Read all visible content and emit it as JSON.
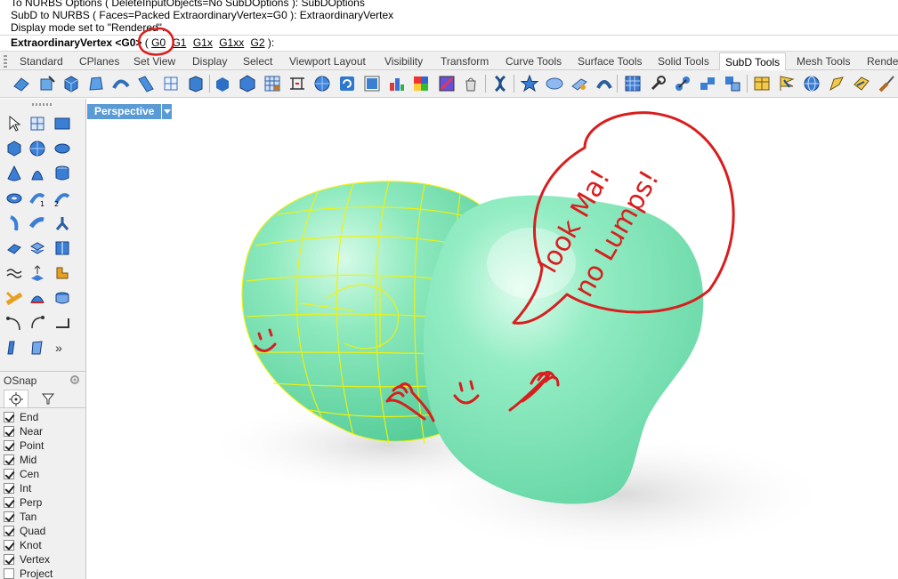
{
  "command_history": {
    "lines": [
      "To NURBS Options ( DeleteInputObjects=No  SubDOptions ): SubDOptions",
      "SubD to NURBS ( Faces=Packed  ExtraordinaryVertex=G0 ): ExtraordinaryVertex",
      "Display mode set to \"Rendered\"."
    ]
  },
  "command_prompt": {
    "prompt": "ExtraordinaryVertex <G0>",
    "open_paren": "( ",
    "options": [
      "G0",
      "G1",
      "G1x",
      "G1xx",
      "G2"
    ],
    "close": " ):"
  },
  "tabs": [
    "Standard",
    "CPlanes",
    "Set View",
    "Display",
    "Select",
    "Viewport Layout",
    "Visibility",
    "Transform",
    "Curve Tools",
    "Surface Tools",
    "Solid Tools",
    "SubD Tools",
    "Mesh Tools",
    "Rende"
  ],
  "active_tab": "SubD Tools",
  "viewport": {
    "title": "Perspective",
    "display_mode": "Rendered"
  },
  "osnap": {
    "title": "OSnap",
    "items": [
      {
        "label": "End",
        "checked": true
      },
      {
        "label": "Near",
        "checked": true
      },
      {
        "label": "Point",
        "checked": true
      },
      {
        "label": "Mid",
        "checked": true
      },
      {
        "label": "Cen",
        "checked": true
      },
      {
        "label": "Int",
        "checked": true
      },
      {
        "label": "Perp",
        "checked": true
      },
      {
        "label": "Tan",
        "checked": true
      },
      {
        "label": "Quad",
        "checked": true
      },
      {
        "label": "Knot",
        "checked": true
      },
      {
        "label": "Vertex",
        "checked": true
      },
      {
        "label": "Project",
        "checked": false
      }
    ]
  },
  "annotations": {
    "line1": "look Ma!",
    "line2": "no Lumps!",
    "color": "#d81e1e"
  },
  "colors": {
    "subd_surface": "#7fe6b4",
    "wireframe": "#f2f20a",
    "viewport_title_bg": "#5b9bd5"
  },
  "left_panel": {
    "more_glyph": "»"
  }
}
